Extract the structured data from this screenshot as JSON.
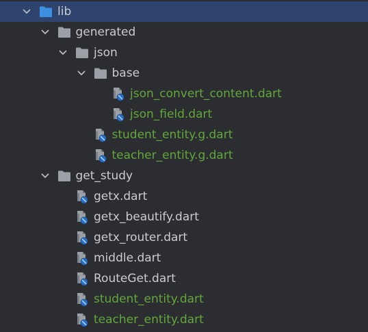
{
  "colors": {
    "background": "#2b2d30",
    "selection": "#2e436e",
    "text": "#c9ccd1",
    "vcs_added": "#62a73b",
    "folder": "#9aa0a6",
    "folder_selected": "#3d8fe0",
    "chevron": "#b7bcc2"
  },
  "tree": [
    {
      "label": "lib",
      "type": "folder",
      "depth": 0,
      "expanded": true,
      "selected": true
    },
    {
      "label": "generated",
      "type": "folder",
      "depth": 1,
      "expanded": true
    },
    {
      "label": "json",
      "type": "folder",
      "depth": 2,
      "expanded": true
    },
    {
      "label": "base",
      "type": "folder",
      "depth": 3,
      "expanded": true
    },
    {
      "label": "json_convert_content.dart",
      "type": "dart-file",
      "depth": 4,
      "vcs": "added"
    },
    {
      "label": "json_field.dart",
      "type": "dart-file",
      "depth": 4,
      "vcs": "added"
    },
    {
      "label": "student_entity.g.dart",
      "type": "dart-file",
      "depth": 3,
      "vcs": "added"
    },
    {
      "label": "teacher_entity.g.dart",
      "type": "dart-file",
      "depth": 3,
      "vcs": "added"
    },
    {
      "label": "get_study",
      "type": "folder",
      "depth": 1,
      "expanded": true
    },
    {
      "label": "getx.dart",
      "type": "dart-file",
      "depth": 2
    },
    {
      "label": "getx_beautify.dart",
      "type": "dart-file",
      "depth": 2
    },
    {
      "label": "getx_router.dart",
      "type": "dart-file",
      "depth": 2
    },
    {
      "label": "middle.dart",
      "type": "dart-file",
      "depth": 2
    },
    {
      "label": "RouteGet.dart",
      "type": "dart-file",
      "depth": 2
    },
    {
      "label": "student_entity.dart",
      "type": "dart-file",
      "depth": 2,
      "vcs": "added"
    },
    {
      "label": "teacher_entity.dart",
      "type": "dart-file",
      "depth": 2,
      "vcs": "added"
    }
  ]
}
